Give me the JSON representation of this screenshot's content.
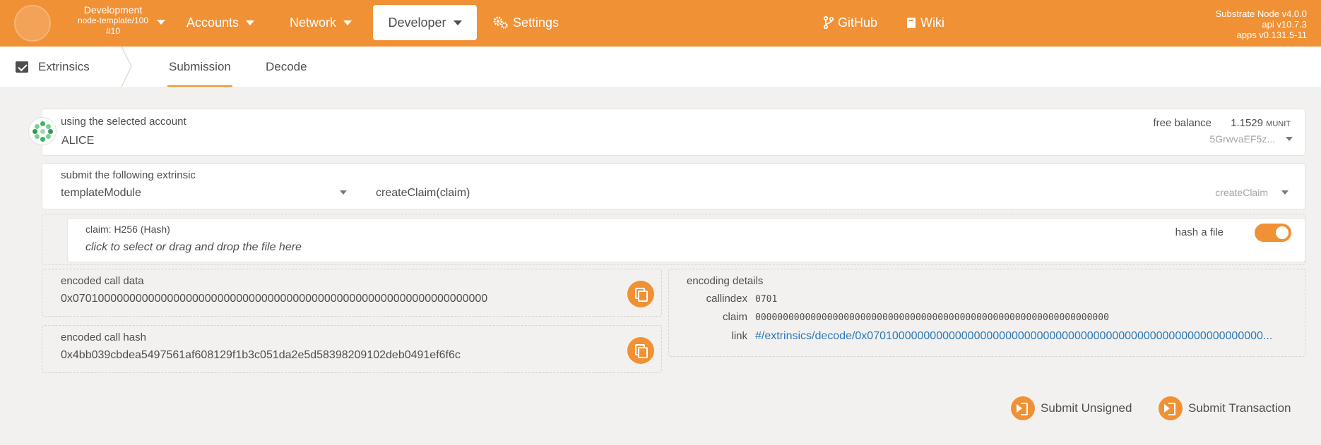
{
  "header": {
    "chain": {
      "name": "Development",
      "runtime": "node-template/100",
      "block": "#10"
    },
    "nav": [
      {
        "label": "Accounts",
        "has_caret": true
      },
      {
        "label": "Network",
        "has_caret": true
      },
      {
        "label": "Developer",
        "has_caret": true,
        "active": true
      },
      {
        "label": "Settings",
        "icon": "gears-icon"
      },
      {
        "label": "GitHub",
        "icon": "code-branch-icon"
      },
      {
        "label": "Wiki",
        "icon": "book-icon"
      }
    ],
    "version": {
      "node": "Substrate Node v4.0.0",
      "api": "api v10.7.3",
      "apps": "apps v0.131.5-11"
    }
  },
  "subnav": {
    "section": "Extrinsics",
    "tabs": [
      {
        "label": "Submission",
        "active": true
      },
      {
        "label": "Decode"
      }
    ]
  },
  "account": {
    "label": "using the selected account",
    "name": "ALICE",
    "balance_label": "free balance",
    "balance_value": "1.1529",
    "balance_unit": "MUNIT",
    "address": "5GrwvaEF5z..."
  },
  "extrinsic": {
    "label": "submit the following extrinsic",
    "module": "templateModule",
    "call_signature": "createClaim(claim)",
    "call_name": "createClaim"
  },
  "param": {
    "label": "claim: H256 (Hash)",
    "placeholder": "click to select or drag and drop the file here",
    "toggle_label": "hash a file",
    "toggle_on": true
  },
  "encoded_call_data": {
    "label": "encoded call data",
    "value": "0x070100000000000000000000000000000000000000000000000000000000000000"
  },
  "encoded_call_hash": {
    "label": "encoded call hash",
    "value": "0x4bb039cbdea5497561af608129f1b3c051da2e5d58398209102deb0491ef6f6c"
  },
  "encoding_details": {
    "title": "encoding details",
    "callindex_label": "callindex",
    "callindex_value": "0701",
    "claim_label": "claim",
    "claim_value": "0000000000000000000000000000000000000000000000000000000000000000",
    "link_label": "link",
    "link_value": "#/extrinsics/decode/0x070100000000000000000000000000000000000000000000000000000000000..."
  },
  "actions": {
    "submit_unsigned": "Submit Unsigned",
    "submit_transaction": "Submit Transaction"
  },
  "colors": {
    "accent": "#f19135",
    "link": "#2b78b8",
    "background": "#f2f1ef"
  }
}
